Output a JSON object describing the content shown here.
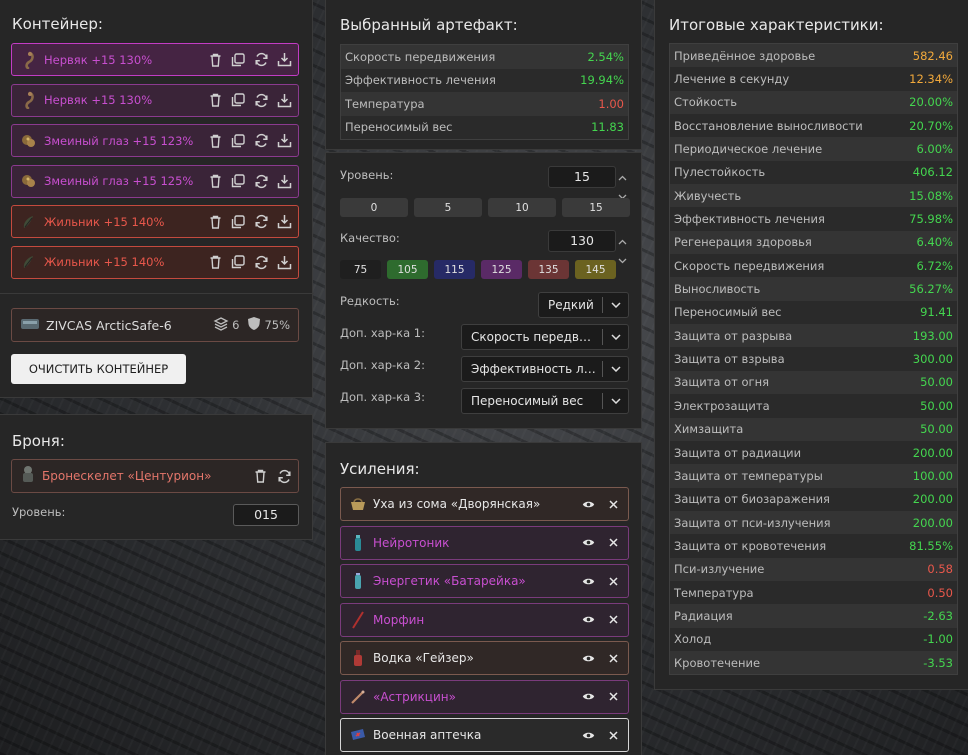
{
  "container": {
    "title": "Контейнер:",
    "artifacts": [
      {
        "name": "Нервяк +15 130%",
        "color": "purple",
        "selected": true
      },
      {
        "name": "Нервяк +15 130%",
        "color": "purple",
        "selected": false
      },
      {
        "name": "Змеиный глаз +15 123%",
        "color": "purple",
        "selected": false
      },
      {
        "name": "Змеиный глаз +15 125%",
        "color": "purple",
        "selected": false
      },
      {
        "name": "Жильник +15 140%",
        "color": "red",
        "selected": false
      },
      {
        "name": "Жильник +15 140%",
        "color": "red",
        "selected": false
      }
    ],
    "container_name": "ZIVCAS ArcticSafe-6",
    "slots": "6",
    "protection": "75%",
    "clear_button": "ОЧИСТИТЬ КОНТЕЙНЕР"
  },
  "armor": {
    "title": "Броня:",
    "name": "Бронескелет «Центурион»",
    "level_label": "Уровень:",
    "level_value": "015"
  },
  "selected": {
    "title": "Выбранный артефакт:",
    "stats": [
      {
        "label": "Скорость передвижения",
        "value": "2.54%",
        "tone": "green"
      },
      {
        "label": "Эффективность лечения",
        "value": "19.94%",
        "tone": "green"
      },
      {
        "label": "Температура",
        "value": "1.00",
        "tone": "red"
      },
      {
        "label": "Переносимый вес",
        "value": "11.83",
        "tone": "green"
      }
    ]
  },
  "settings": {
    "level_label": "Уровень:",
    "level_value": "15",
    "level_buttons": [
      "0",
      "5",
      "10",
      "15"
    ],
    "quality_label": "Качество:",
    "quality_value": "130",
    "quality_buttons": [
      {
        "label": "75",
        "color": "#1f1f1f"
      },
      {
        "label": "105",
        "color": "#2e6b2e"
      },
      {
        "label": "115",
        "color": "#262a66"
      },
      {
        "label": "125",
        "color": "#5a2a66"
      },
      {
        "label": "135",
        "color": "#6b3535"
      },
      {
        "label": "145",
        "color": "#6b6220"
      }
    ],
    "rarity_label": "Редкость:",
    "rarity_value": "Редкий",
    "extra1_label": "Доп. хар-ка 1:",
    "extra1_value": "Скорость передвижения",
    "extra2_label": "Доп. хар-ка 2:",
    "extra2_value": "Эффективность лечения",
    "extra3_label": "Доп. хар-ка 3:",
    "extra3_value": "Переносимый вес"
  },
  "boosts": {
    "title": "Усиления:",
    "items": [
      {
        "name": "Уха из сома «Дворянская»",
        "style": "tan"
      },
      {
        "name": "Нейротоник",
        "style": "purple"
      },
      {
        "name": "Энергетик «Батарейка»",
        "style": "purple"
      },
      {
        "name": "Морфин",
        "style": "purple"
      },
      {
        "name": "Водка «Гейзер»",
        "style": "tan"
      },
      {
        "name": "«Астрикцин»",
        "style": "purple"
      },
      {
        "name": "Военная аптечка",
        "style": "white"
      }
    ]
  },
  "totals": {
    "title": "Итоговые характеристики:",
    "stats": [
      {
        "label": "Приведённое здоровье",
        "value": "582.46",
        "tone": "orange"
      },
      {
        "label": "Лечение в секунду",
        "value": "12.34%",
        "tone": "orange"
      },
      {
        "label": "Стойкость",
        "value": "20.00%",
        "tone": "green"
      },
      {
        "label": "Восстановление выносливости",
        "value": "20.70%",
        "tone": "green"
      },
      {
        "label": "Периодическое лечение",
        "value": "6.00%",
        "tone": "green"
      },
      {
        "label": "Пулестойкость",
        "value": "406.12",
        "tone": "green"
      },
      {
        "label": "Живучесть",
        "value": "15.08%",
        "tone": "green"
      },
      {
        "label": "Эффективность лечения",
        "value": "75.98%",
        "tone": "green"
      },
      {
        "label": "Регенерация здоровья",
        "value": "6.40%",
        "tone": "green"
      },
      {
        "label": "Скорость передвижения",
        "value": "6.72%",
        "tone": "green"
      },
      {
        "label": "Выносливость",
        "value": "56.27%",
        "tone": "green"
      },
      {
        "label": "Переносимый вес",
        "value": "91.41",
        "tone": "green"
      },
      {
        "label": "Защита от разрыва",
        "value": "193.00",
        "tone": "green"
      },
      {
        "label": "Защита от взрыва",
        "value": "300.00",
        "tone": "green"
      },
      {
        "label": "Защита от огня",
        "value": "50.00",
        "tone": "green"
      },
      {
        "label": "Электрозащита",
        "value": "50.00",
        "tone": "green"
      },
      {
        "label": "Химзащита",
        "value": "50.00",
        "tone": "green"
      },
      {
        "label": "Защита от радиации",
        "value": "200.00",
        "tone": "green"
      },
      {
        "label": "Защита от температуры",
        "value": "100.00",
        "tone": "green"
      },
      {
        "label": "Защита от биозаражения",
        "value": "200.00",
        "tone": "green"
      },
      {
        "label": "Защита от пси-излучения",
        "value": "200.00",
        "tone": "green"
      },
      {
        "label": "Защита от кровотечения",
        "value": "81.55%",
        "tone": "green"
      },
      {
        "label": "Пси-излучение",
        "value": "0.58",
        "tone": "red"
      },
      {
        "label": "Температура",
        "value": "0.50",
        "tone": "red"
      },
      {
        "label": "Радиация",
        "value": "-2.63",
        "tone": "green"
      },
      {
        "label": "Холод",
        "value": "-1.00",
        "tone": "green"
      },
      {
        "label": "Кровотечение",
        "value": "-3.53",
        "tone": "green"
      }
    ]
  }
}
